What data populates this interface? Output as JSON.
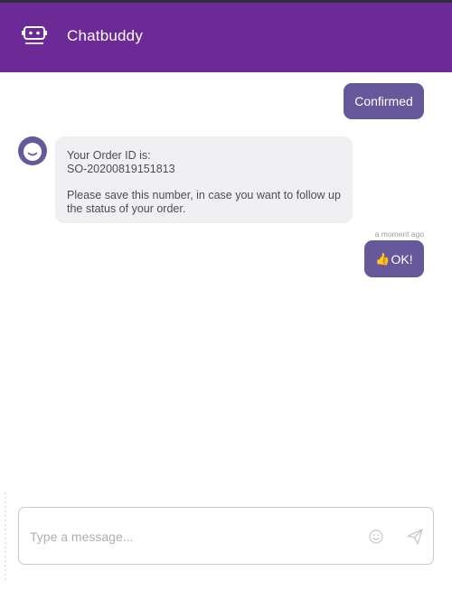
{
  "header": {
    "logo_icon": "chatbuddy-robot-icon",
    "title": "Chatbuddy",
    "background": "#6b2a96"
  },
  "messages": [
    {
      "from": "user",
      "text": "Confirmed"
    },
    {
      "from": "bot",
      "avatar_icon": "smiley-avatar-icon",
      "line1": "Your Order ID is:",
      "line2": "SO-20200819151813",
      "line3": "Please save this number, in case you want to follow up the status of your order."
    },
    {
      "from": "user",
      "timestamp": "a moment ago",
      "emoji": "👍",
      "text": "OK!"
    }
  ],
  "composer": {
    "placeholder": "Type a message...",
    "emoji_icon": "smiley-icon",
    "send_icon": "paper-plane-icon"
  },
  "colors": {
    "user_bubble": "#66589a",
    "bot_bubble": "#f0f0f2",
    "bot_text": "#4a4e59"
  }
}
